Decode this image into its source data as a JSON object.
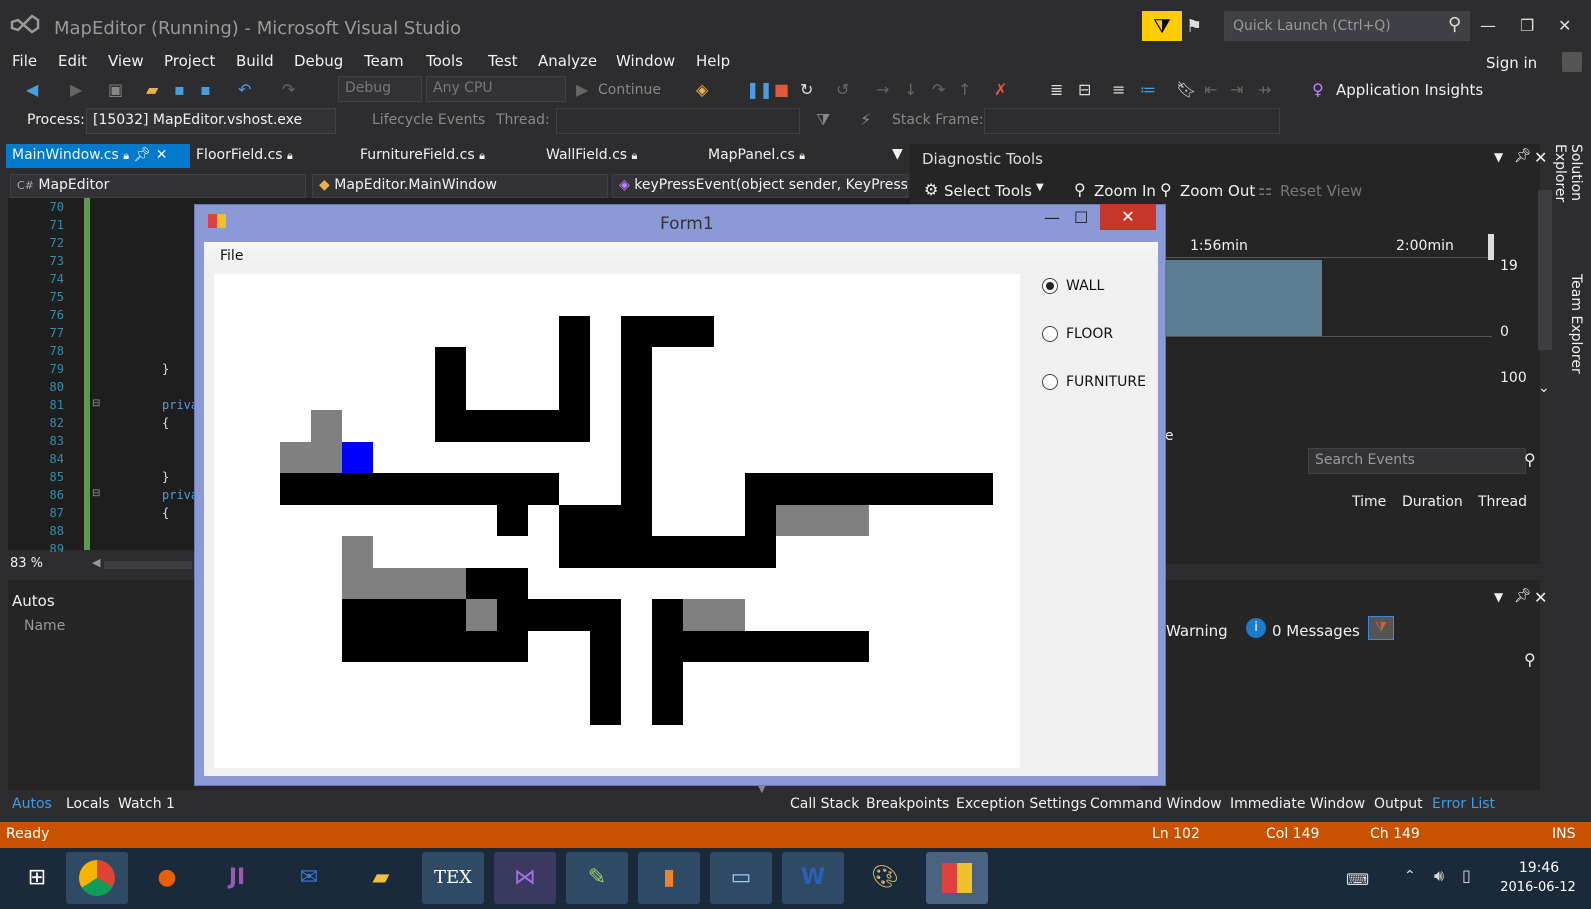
{
  "window": {
    "title": "MapEditor (Running) - Microsoft Visual Studio",
    "quick_launch_placeholder": "Quick Launch (Ctrl+Q)",
    "sign_in": "Sign in"
  },
  "menu": [
    "File",
    "Edit",
    "View",
    "Project",
    "Build",
    "Debug",
    "Team",
    "Tools",
    "Test",
    "Analyze",
    "Window",
    "Help"
  ],
  "toolbar": {
    "config": "Debug",
    "platform": "Any CPU",
    "continue": "Continue",
    "app_insights": "Application Insights"
  },
  "debugbar": {
    "process_label": "Process:",
    "process_value": "[15032] MapEditor.vshost.exe",
    "lifecycle": "Lifecycle Events",
    "thread_label": "Thread:",
    "stackframe_label": "Stack Frame:"
  },
  "tabs": [
    "MainWindow.cs",
    "FloorField.cs",
    "FurnitureField.cs",
    "WallField.cs",
    "MapPanel.cs"
  ],
  "nav": {
    "project": "MapEditor",
    "class": "MapEditor.MainWindow",
    "member": "keyPressEvent(object sender, KeyPressI"
  },
  "editor": {
    "line_numbers": [
      "70",
      "71",
      "72",
      "73",
      "74",
      "75",
      "76",
      "77",
      "78",
      "79",
      "80",
      "81",
      "82",
      "83",
      "84",
      "85",
      "86",
      "87",
      "88",
      "89"
    ],
    "code": {
      "l79": "}",
      "l81": "priva",
      "l82": "{",
      "l85": "}",
      "l86": "priva",
      "l87": "{"
    },
    "zoom": "83 %"
  },
  "autos": {
    "title": "Autos",
    "col_name": "Name"
  },
  "diagnostics": {
    "title": "Diagnostic Tools",
    "select_tools": "Select Tools",
    "zoom_in": "Zoom In",
    "zoom_out": "Zoom Out",
    "reset_view": "Reset View",
    "t1": "1:56min",
    "t2": "2:00min",
    "y1": "19",
    "y2": "0",
    "y3": "100",
    "section": "ge",
    "search": "Search Events",
    "col_time": "Time",
    "col_duration": "Duration",
    "col_thread": "Thread"
  },
  "errors": {
    "warning": "Warning",
    "messages": "0 Messages"
  },
  "side": {
    "solution_explorer": "Solution Explorer",
    "team_explorer": "Team Explorer"
  },
  "bottom_tabs_left": [
    "Autos",
    "Locals",
    "Watch 1"
  ],
  "bottom_tabs_right": [
    "Call Stack",
    "Breakpoints",
    "Exception Settings",
    "Command Window",
    "Immediate Window",
    "Output",
    "Error List"
  ],
  "status": {
    "ready": "Ready",
    "ln": "Ln 102",
    "col": "Col 149",
    "ch": "Ch 149",
    "ins": "INS"
  },
  "clock": {
    "time": "19:46",
    "date": "2016-06-12"
  },
  "form1": {
    "title": "Form1",
    "menu_file": "File",
    "options": [
      {
        "label": "WALL",
        "checked": true
      },
      {
        "label": "FLOOR",
        "checked": false
      },
      {
        "label": "FURNITURE",
        "checked": false
      }
    ],
    "grid": {
      "cols": 26,
      "rows": 15,
      "cells_black": [
        [
          11,
          1
        ],
        [
          13,
          1
        ],
        [
          14,
          1
        ],
        [
          15,
          1
        ],
        [
          7,
          2
        ],
        [
          11,
          2
        ],
        [
          13,
          2
        ],
        [
          7,
          3
        ],
        [
          11,
          3
        ],
        [
          13,
          3
        ],
        [
          7,
          4
        ],
        [
          8,
          4
        ],
        [
          9,
          4
        ],
        [
          10,
          4
        ],
        [
          11,
          4
        ],
        [
          13,
          4
        ],
        [
          13,
          5
        ],
        [
          2,
          6
        ],
        [
          3,
          6
        ],
        [
          4,
          6
        ],
        [
          5,
          6
        ],
        [
          6,
          6
        ],
        [
          7,
          6
        ],
        [
          8,
          6
        ],
        [
          9,
          6
        ],
        [
          10,
          6
        ],
        [
          13,
          6
        ],
        [
          17,
          6
        ],
        [
          18,
          6
        ],
        [
          19,
          6
        ],
        [
          20,
          6
        ],
        [
          21,
          6
        ],
        [
          22,
          6
        ],
        [
          23,
          6
        ],
        [
          24,
          6
        ],
        [
          9,
          7
        ],
        [
          11,
          7
        ],
        [
          12,
          7
        ],
        [
          13,
          7
        ],
        [
          17,
          7
        ],
        [
          11,
          8
        ],
        [
          12,
          8
        ],
        [
          13,
          8
        ],
        [
          14,
          8
        ],
        [
          15,
          8
        ],
        [
          16,
          8
        ],
        [
          17,
          8
        ],
        [
          8,
          9
        ],
        [
          9,
          9
        ],
        [
          4,
          10
        ],
        [
          5,
          10
        ],
        [
          6,
          10
        ],
        [
          7,
          10
        ],
        [
          9,
          10
        ],
        [
          10,
          10
        ],
        [
          11,
          10
        ],
        [
          12,
          10
        ],
        [
          14,
          10
        ],
        [
          4,
          11
        ],
        [
          5,
          11
        ],
        [
          6,
          11
        ],
        [
          7,
          11
        ],
        [
          8,
          11
        ],
        [
          9,
          11
        ],
        [
          12,
          11
        ],
        [
          14,
          11
        ],
        [
          15,
          11
        ],
        [
          16,
          11
        ],
        [
          17,
          11
        ],
        [
          18,
          11
        ],
        [
          19,
          11
        ],
        [
          20,
          11
        ],
        [
          12,
          12
        ],
        [
          14,
          12
        ],
        [
          12,
          13
        ],
        [
          14,
          13
        ]
      ],
      "cells_gray": [
        [
          3,
          4
        ],
        [
          2,
          5
        ],
        [
          3,
          5
        ],
        [
          18,
          7
        ],
        [
          19,
          7
        ],
        [
          20,
          7
        ],
        [
          4,
          8
        ],
        [
          4,
          9
        ],
        [
          5,
          9
        ],
        [
          6,
          9
        ],
        [
          7,
          9
        ],
        [
          8,
          10
        ],
        [
          15,
          10
        ],
        [
          16,
          10
        ]
      ],
      "cells_blue": [
        [
          4,
          5
        ]
      ]
    }
  },
  "taskbar_icons": [
    "start-icon",
    "chrome-icon",
    "firefox-icon",
    "jetbrains-icon",
    "thunderbird-icon",
    "explorer-icon",
    "tex-icon",
    "visualstudio-icon",
    "notepad-icon",
    "pdf-icon",
    "remote-icon",
    "word-icon",
    "paint-icon",
    "app-icon"
  ]
}
